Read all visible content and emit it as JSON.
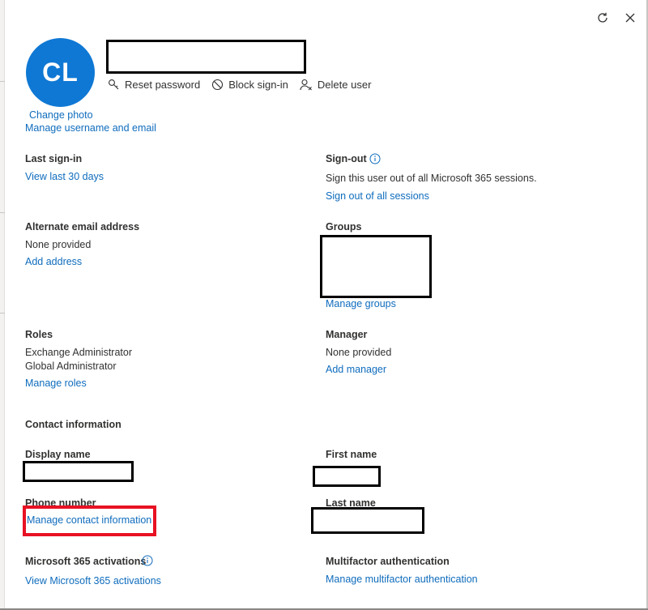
{
  "header": {
    "avatar_initials": "CL",
    "change_photo": "Change photo",
    "manage_username": "Manage username and email",
    "actions": {
      "reset_password": "Reset password",
      "block_signin": "Block sign-in",
      "delete_user": "Delete user"
    },
    "top_icons": [
      "refresh-icon",
      "close-icon"
    ]
  },
  "sections": {
    "last_signin": {
      "label": "Last sign-in",
      "link": "View last 30 days"
    },
    "signout": {
      "label": "Sign-out",
      "description": "Sign this user out of all Microsoft 365 sessions.",
      "link": "Sign out of all sessions"
    },
    "alternate_email": {
      "label": "Alternate email address",
      "value": "None provided",
      "link": "Add address"
    },
    "groups": {
      "label": "Groups",
      "link": "Manage groups"
    },
    "roles": {
      "label": "Roles",
      "values": [
        "Exchange Administrator",
        "Global Administrator"
      ],
      "link": "Manage roles"
    },
    "manager": {
      "label": "Manager",
      "value": "None provided",
      "link": "Add manager"
    },
    "contact": {
      "heading": "Contact information",
      "display_name_label": "Display name",
      "first_name_label": "First name",
      "phone_label": "Phone number",
      "phone_link": "Manage contact information",
      "last_name_label": "Last name"
    },
    "activations": {
      "label": "Microsoft 365 activations",
      "link": "View Microsoft 365 activations"
    },
    "mfa": {
      "label": "Multifactor authentication",
      "link": "Manage multifactor authentication"
    }
  },
  "colors": {
    "accent": "#0f6cbd",
    "avatar": "#0f78d4",
    "highlight": "#e81123"
  }
}
